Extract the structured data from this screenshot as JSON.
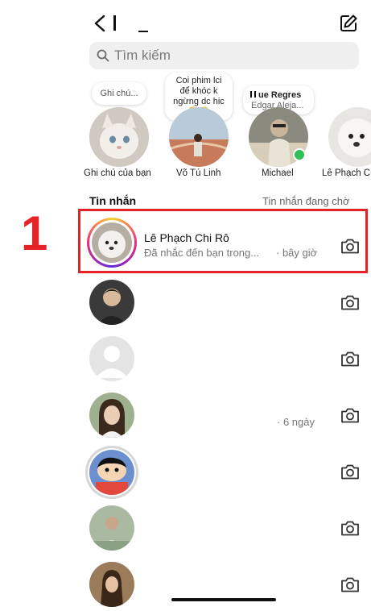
{
  "header": {
    "title": "",
    "back_icon": "chevron-left-icon",
    "compose_icon": "compose-icon"
  },
  "search": {
    "placeholder": "Tìm kiếm"
  },
  "notes": [
    {
      "label": "Ghi chú của bạn",
      "bubble": "Ghi chú..."
    },
    {
      "label": "Võ Tú Linh",
      "bubble_lines": [
        "Coi phim lci",
        "để khóc k",
        "ngừng dc hic",
        "😢😢"
      ]
    },
    {
      "label": "Michael",
      "music_title": "ue Regres",
      "music_artist": "Edgar Aleja...",
      "online": true
    },
    {
      "label": "Lê Phạch C"
    }
  ],
  "messages_header": {
    "left": "Tin nhắn",
    "right": "Tin nhắn đang chờ"
  },
  "annotation": {
    "number": "1",
    "color": "#e52226"
  },
  "messages": [
    {
      "name": "Lê Phạch Chi Rô",
      "preview": "Đã nhắc đến bạn trong...",
      "time": "· bây giờ",
      "story_ring": true
    },
    {
      "name": "",
      "preview": "",
      "time": ""
    },
    {
      "name": "",
      "preview": "",
      "time": ""
    },
    {
      "name": "",
      "preview": "",
      "time": "· 6 ngày"
    },
    {
      "name": "",
      "preview": "",
      "time": ""
    },
    {
      "name": "",
      "preview": "",
      "time": ""
    },
    {
      "name": "",
      "preview": "",
      "time": ""
    }
  ],
  "colors": {
    "accent_red": "#e52226",
    "online_green": "#2ec255",
    "search_bg": "#efefef"
  }
}
